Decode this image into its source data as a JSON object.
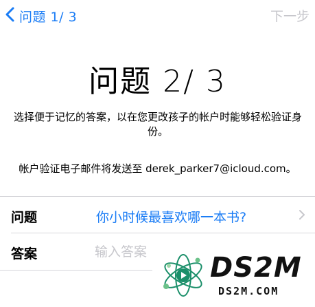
{
  "nav": {
    "back_label": "问题 1/ 3",
    "next_label": "下一步"
  },
  "title": "问题 2/ 3",
  "description": "选择便于记忆的答案，以在您更改孩子的帐户时能够轻松验证身份。",
  "email_note": "帐户验证电子邮件将发送至 derek_parker7@icloud.com。",
  "form": {
    "question_label": "问题",
    "question_value": "你小时候最喜欢哪一本书?",
    "answer_label": "答案",
    "answer_placeholder": "输入答案"
  },
  "watermark": {
    "brand": "DS2M",
    "domain": "DS2M.COM"
  },
  "colors": {
    "accent": "#1a7cf5",
    "disabled": "#c7c7cc",
    "separator": "#d6d6da"
  }
}
